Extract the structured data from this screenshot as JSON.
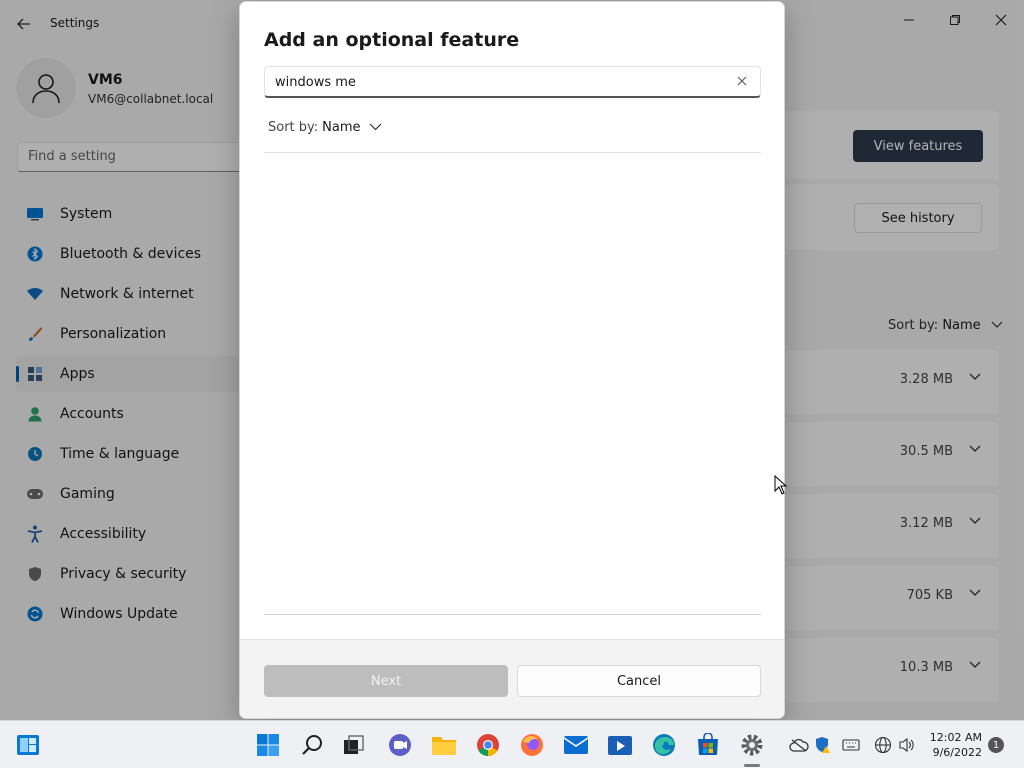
{
  "settings": {
    "title": "Settings",
    "user": {
      "name": "VM6",
      "email": "VM6@collabnet.local"
    },
    "find_placeholder": "Find a setting",
    "nav": [
      {
        "label": "System",
        "icon": "monitor-icon",
        "color": "#0078d4"
      },
      {
        "label": "Bluetooth & devices",
        "icon": "bluetooth-icon",
        "color": "#0078d4"
      },
      {
        "label": "Network & internet",
        "icon": "wifi-icon",
        "color": "#0f6cbd"
      },
      {
        "label": "Personalization",
        "icon": "brush-icon",
        "color": "#c46a1c"
      },
      {
        "label": "Apps",
        "icon": "apps-icon",
        "color": "#3a5a7a",
        "active": true
      },
      {
        "label": "Accounts",
        "icon": "person-icon",
        "color": "#2fa36b"
      },
      {
        "label": "Time & language",
        "icon": "clock-globe-icon",
        "color": "#0a78b8"
      },
      {
        "label": "Gaming",
        "icon": "gamepad-icon",
        "color": "#6b6b6b"
      },
      {
        "label": "Accessibility",
        "icon": "accessibility-icon",
        "color": "#1e5fa8"
      },
      {
        "label": "Privacy & security",
        "icon": "shield-icon",
        "color": "#6b6b6b"
      },
      {
        "label": "Windows Update",
        "icon": "update-icon",
        "color": "#0a78d4"
      }
    ],
    "view_features_label": "View features",
    "see_history_label": "See history",
    "sort_label": "Sort by:",
    "sort_value": "Name",
    "sizes": [
      "3.28 MB",
      "30.5 MB",
      "3.12 MB",
      "705 KB",
      "10.3 MB"
    ]
  },
  "dialog": {
    "title": "Add an optional feature",
    "search_value": "windows me",
    "sort_label": "Sort by:",
    "sort_value": "Name",
    "next_label": "Next",
    "cancel_label": "Cancel"
  },
  "taskbar": {
    "time": "12:02 AM",
    "date": "9/6/2022",
    "notification_count": "1",
    "accent": "#0078d4"
  }
}
